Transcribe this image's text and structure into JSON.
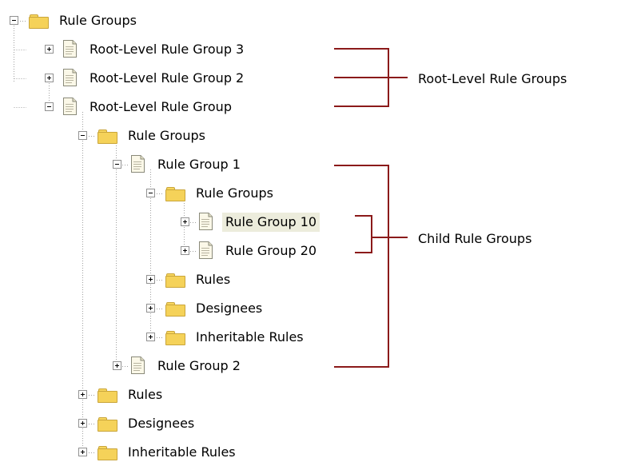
{
  "tree": {
    "root": {
      "label": "Rule Groups"
    },
    "nodes": [
      {
        "label": "Root-Level Rule Group 3"
      },
      {
        "label": "Root-Level Rule Group 2"
      },
      {
        "label": "Root-Level Rule Group"
      },
      {
        "label": "Rule Groups"
      },
      {
        "label": "Rule Group 1"
      },
      {
        "label": "Rule Groups"
      },
      {
        "label": "Rule Group 10"
      },
      {
        "label": "Rule Group 20"
      },
      {
        "label": "Rules"
      },
      {
        "label": "Designees"
      },
      {
        "label": "Inheritable Rules"
      },
      {
        "label": "Rule Group 2"
      },
      {
        "label": "Rules"
      },
      {
        "label": "Designees"
      },
      {
        "label": "Inheritable Rules"
      }
    ]
  },
  "annotations": {
    "root_level": "Root-Level Rule Groups",
    "child": "Child Rule Groups"
  },
  "colors": {
    "bracket": "#8b1a1a",
    "selection": "#ececdc",
    "folder": "#f5d259",
    "tree_line": "#a0a0a0"
  }
}
